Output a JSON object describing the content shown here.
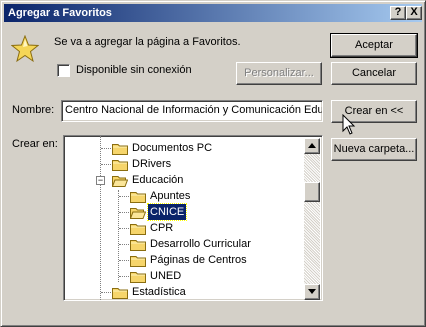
{
  "window": {
    "title": "Agregar a Favoritos",
    "help_button": "?",
    "close_button": "X"
  },
  "message": "Se va a agregar la página a Favoritos.",
  "offline": {
    "label": "Disponible sin conexión",
    "checked": false
  },
  "buttons": {
    "accept": "Aceptar",
    "cancel": "Cancelar",
    "customize": "Personalizar...",
    "create_in": "Crear en <<",
    "new_folder": "Nueva carpeta..."
  },
  "name_field": {
    "label": "Nombre:",
    "value": "Centro Nacional de Información y Comunicación Educ"
  },
  "create_in_label": "Crear en:",
  "tree": {
    "items": [
      {
        "label": "Documentos PC",
        "level": 1,
        "selected": false
      },
      {
        "label": "DRivers",
        "level": 1,
        "selected": false
      },
      {
        "label": "Educación",
        "level": 1,
        "selected": false,
        "expanded": true
      },
      {
        "label": "Apuntes",
        "level": 2,
        "selected": false
      },
      {
        "label": "CNICE",
        "level": 2,
        "selected": true
      },
      {
        "label": "CPR",
        "level": 2,
        "selected": false
      },
      {
        "label": "Desarrollo Curricular",
        "level": 2,
        "selected": false
      },
      {
        "label": "Páginas de Centros",
        "level": 2,
        "selected": false
      },
      {
        "label": "UNED",
        "level": 2,
        "selected": false
      },
      {
        "label": "Estadística",
        "level": 1,
        "selected": false
      }
    ]
  },
  "colors": {
    "dialog_bg": "#d4d0c8",
    "title_start": "#0a246a",
    "title_end": "#a6caf0",
    "selection": "#0a246a",
    "folder": "#f6d56b"
  }
}
